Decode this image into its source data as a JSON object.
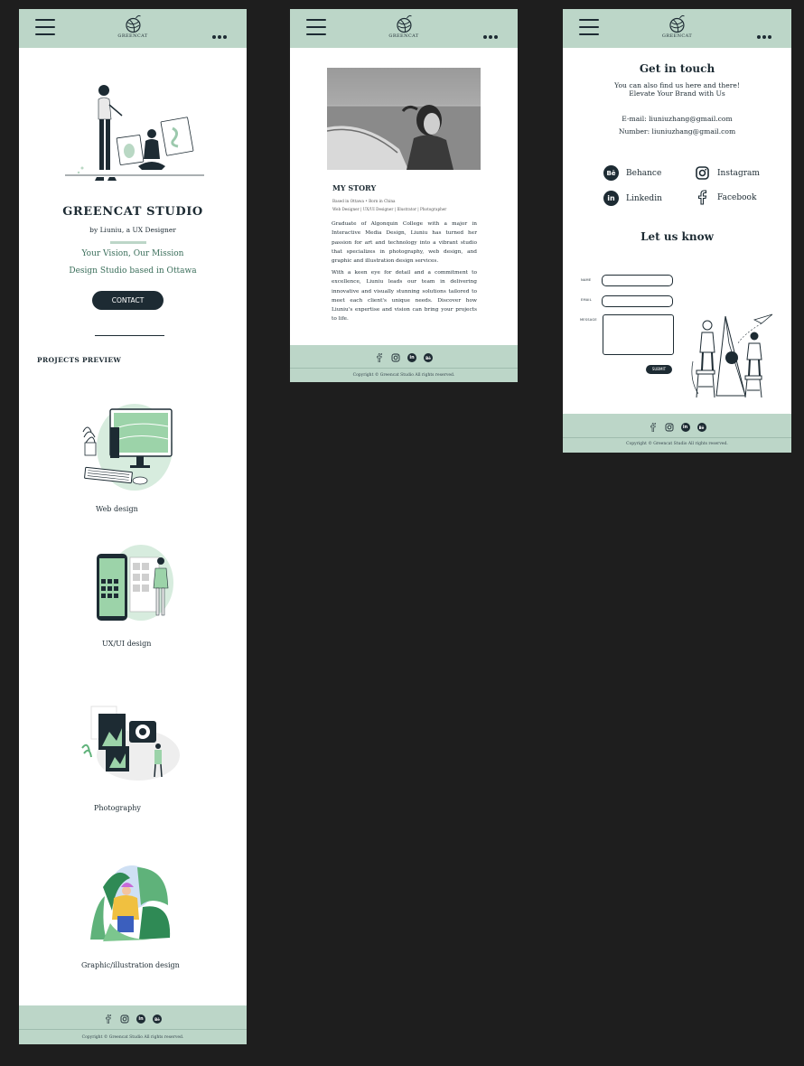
{
  "brand": {
    "logo_text": "GREENCAT",
    "accent": "#bcd6c8",
    "dark": "#1d2b33"
  },
  "home": {
    "title": "GREENCAT STUDIO",
    "byline": "by Liuniu, a UX Designer",
    "tagline1": "Your Vision, Our Mission",
    "tagline2": "Design Studio based in Ottawa",
    "contact_label": "CONTACT",
    "projects_heading": "PROJECTS PREVIEW",
    "projects": [
      {
        "label": "Web design"
      },
      {
        "label": "UX/UI design"
      },
      {
        "label": "Photography"
      },
      {
        "label": "Graphic/illustration design"
      }
    ]
  },
  "story": {
    "heading": "MY STORY",
    "meta1": "Based in Ottawa • Born in China",
    "meta2": "Web Designer | UX/UI Designer | Illustrator | Photographer",
    "para1": "Graduate of Algonquin College with a major in Interactive Media Design, Liuniu has turned her passion for art and technology into a vibrant studio that specializes in photography, web design, and graphic and illustration design services.",
    "para2": "With a keen eye for detail and a commitment to excellence, Liuniu leads our team in delivering innovative and visually stunning solutions tailored to meet each client's unique needs. Discover how Liuniu's expertise and vision can bring your projects to life."
  },
  "contact": {
    "heading": "Get in touch",
    "sub1": "You can also find us here and there!",
    "sub2": "Elevate Your Brand with Us",
    "email": "E-mail: liuniuzhang@gmail.com",
    "number": "Number: liuniuzhang@gmail.com",
    "social": [
      {
        "label": "Behance",
        "icon": "behance-icon"
      },
      {
        "label": "Instagram",
        "icon": "instagram-icon"
      },
      {
        "label": "Linkedin",
        "icon": "linkedin-icon"
      },
      {
        "label": "Facebook",
        "icon": "facebook-icon"
      }
    ],
    "form_heading": "Let us know",
    "name_label": "NAME",
    "email_label": "EMAIL",
    "message_label": "MESSAGE",
    "submit_label": "SUBMIT"
  },
  "footer": {
    "copyright": "Copyright © Greencat Studio All rights reserved."
  }
}
